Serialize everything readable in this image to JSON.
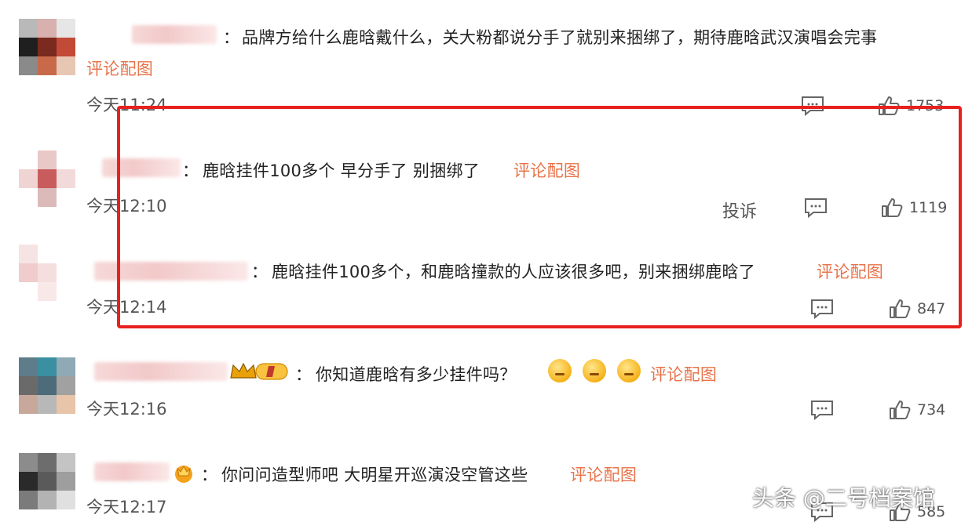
{
  "comments": [
    {
      "text": "品牌方给什么鹿晗戴什么，关大粉都说分手了就别来捆绑了，期待鹿晗武汉演唱会完事",
      "link": "评论配图",
      "time": "今天11:24",
      "likes": "1753"
    },
    {
      "text": "鹿晗挂件100多个 早分手了 别捆绑了 ",
      "link": "评论配图",
      "time": "今天12:10",
      "report": "投诉",
      "likes": "1119"
    },
    {
      "text": "鹿晗挂件100多个，和鹿晗撞款的人应该很多吧，别来捆绑鹿晗了 ",
      "link": "评论配图",
      "time": "今天12:14",
      "likes": "847"
    },
    {
      "badge": "I",
      "text": "你知道鹿晗有多少挂件吗？",
      "link": "评论配图",
      "time": "今天12:16",
      "likes": "734"
    },
    {
      "text": "你问问造型师吧 大明星开巡演没空管这些 ",
      "link": "评论配图",
      "time": "今天12:17",
      "likes": "585"
    }
  ],
  "separator": "：",
  "watermark": "头条 @二号档案馆",
  "icons": [
    "comment-icon",
    "thumbs-up-icon",
    "crown-badge-icon",
    "emoji-icon"
  ],
  "colors": {
    "link": "#e8734a",
    "highlight_box": "#e8211f"
  }
}
